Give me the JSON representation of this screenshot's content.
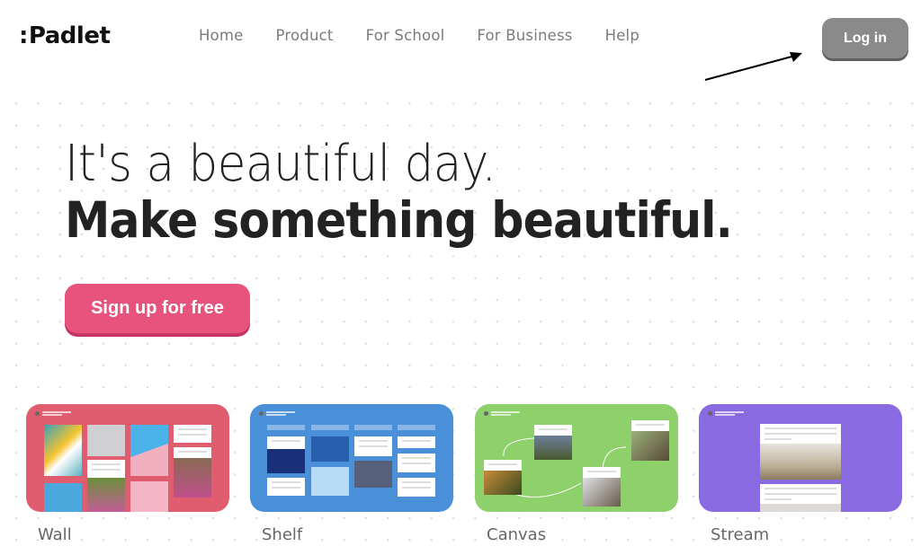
{
  "header": {
    "logo": "Padlet",
    "nav": [
      "Home",
      "Product",
      "For School",
      "For Business",
      "Help"
    ],
    "login_label": "Log in"
  },
  "hero": {
    "line1": "It's a beautiful day.",
    "line2": "Make something beautiful.",
    "cta_label": "Sign up for free"
  },
  "colors": {
    "brand_pink": "#e8537e",
    "login_gray": "#8a8a8a",
    "wall": "#e05d6f",
    "shelf": "#4a90d9",
    "canvas": "#8ed06a",
    "stream": "#8a6ae0"
  },
  "formats": [
    {
      "id": "wall",
      "label": "Wall"
    },
    {
      "id": "shelf",
      "label": "Shelf"
    },
    {
      "id": "canvas",
      "label": "Canvas"
    },
    {
      "id": "stream",
      "label": "Stream"
    }
  ]
}
